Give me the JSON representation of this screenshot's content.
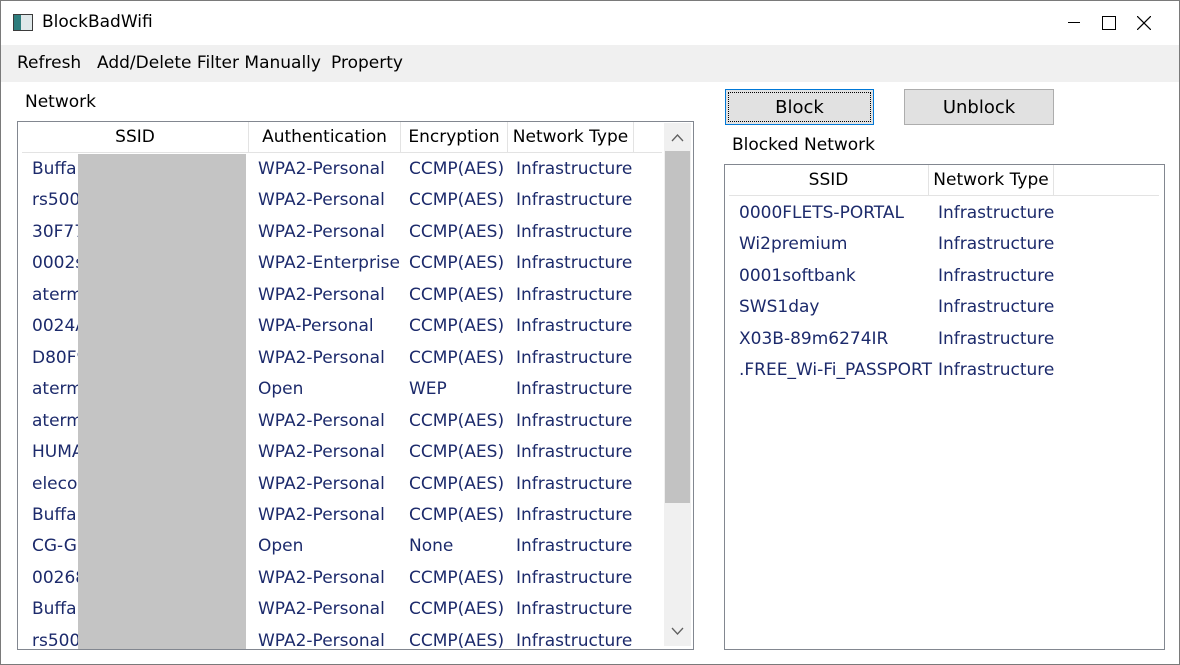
{
  "window": {
    "title": "BlockBadWifi"
  },
  "menu": [
    "Refresh",
    "Add/Delete Filter Manually",
    "Property"
  ],
  "network_panel": {
    "label": "Network",
    "columns": [
      "SSID",
      "Authentication",
      "Encryption",
      "Network Type"
    ],
    "rows": [
      {
        "ssid": "Buffalo",
        "auth": "WPA2-Personal",
        "enc": "CCMP(AES)",
        "type": "Infrastructure"
      },
      {
        "ssid": "rs500m",
        "auth": "WPA2-Personal",
        "enc": "CCMP(AES)",
        "type": "Infrastructure"
      },
      {
        "ssid": "30F77",
        "auth": "WPA2-Personal",
        "enc": "CCMP(AES)",
        "type": "Infrastructure"
      },
      {
        "ssid": "0002s",
        "auth": "WPA2-Enterprise",
        "enc": "CCMP(AES)",
        "type": "Infrastructure"
      },
      {
        "ssid": "aterm",
        "auth": "WPA2-Personal",
        "enc": "CCMP(AES)",
        "type": "Infrastructure"
      },
      {
        "ssid": "0024A",
        "auth": "WPA-Personal",
        "enc": "CCMP(AES)",
        "type": "Infrastructure"
      },
      {
        "ssid": "D80F9",
        "auth": "WPA2-Personal",
        "enc": "CCMP(AES)",
        "type": "Infrastructure"
      },
      {
        "ssid": "aterm",
        "auth": "Open",
        "enc": "WEP",
        "type": "Infrastructure"
      },
      {
        "ssid": "aterm",
        "auth": "WPA2-Personal",
        "enc": "CCMP(AES)",
        "type": "Infrastructure"
      },
      {
        "ssid": "HUMAX",
        "auth": "WPA2-Personal",
        "enc": "CCMP(AES)",
        "type": "Infrastructure"
      },
      {
        "ssid": "elecom",
        "auth": "WPA2-Personal",
        "enc": "CCMP(AES)",
        "type": "Infrastructure"
      },
      {
        "ssid": "Buffalo",
        "auth": "WPA2-Personal",
        "enc": "CCMP(AES)",
        "type": "Infrastructure"
      },
      {
        "ssid": "CG-Gu",
        "auth": "Open",
        "enc": "None",
        "type": "Infrastructure"
      },
      {
        "ssid": "00268",
        "auth": "WPA2-Personal",
        "enc": "CCMP(AES)",
        "type": "Infrastructure"
      },
      {
        "ssid": "Buffalo",
        "auth": "WPA2-Personal",
        "enc": "CCMP(AES)",
        "type": "Infrastructure"
      },
      {
        "ssid": "rs500m",
        "auth": "WPA2-Personal",
        "enc": "CCMP(AES)",
        "type": "Infrastructure"
      }
    ]
  },
  "actions": {
    "block": "Block",
    "unblock": "Unblock"
  },
  "blocked_panel": {
    "label": "Blocked Network",
    "columns": [
      "SSID",
      "Network Type"
    ],
    "rows": [
      {
        "ssid": "0000FLETS-PORTAL",
        "type": "Infrastructure"
      },
      {
        "ssid": "Wi2premium",
        "type": "Infrastructure"
      },
      {
        "ssid": "0001softbank",
        "type": "Infrastructure"
      },
      {
        "ssid": "SWS1day",
        "type": "Infrastructure"
      },
      {
        "ssid": "X03B-89m6274IR",
        "type": "Infrastructure"
      },
      {
        "ssid": ".FREE_Wi-Fi_PASSPORT",
        "type": "Infrastructure"
      }
    ]
  },
  "colors": {
    "cell_text": "#1c2a6b",
    "menubar_bg": "#f0f0f0",
    "button_bg": "#e1e1e1",
    "redaction": "#c4c4c4"
  }
}
